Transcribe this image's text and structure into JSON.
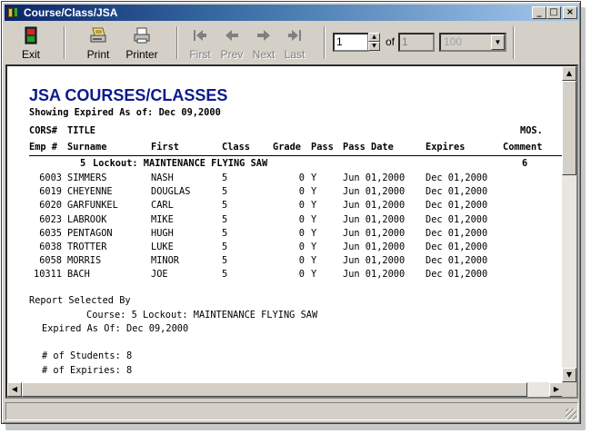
{
  "window": {
    "title": "Course/Class/JSA"
  },
  "toolbar": {
    "exit": "Exit",
    "print": "Print",
    "printer": "Printer",
    "first": "First",
    "prev": "Prev",
    "next": "Next",
    "last": "Last",
    "page_value": "1",
    "of_label": "of",
    "page_total": "1",
    "zoom": "100"
  },
  "report": {
    "title": "JSA COURSES/CLASSES",
    "subtitle": "Showing Expired As of: Dec 09,2000",
    "header1": {
      "cors": "CORS#",
      "title": "TITLE",
      "mos": "MOS."
    },
    "header2": {
      "emp": "Emp #",
      "surname": "Surname",
      "first": "First",
      "class": "Class",
      "grade": "Grade",
      "pass": "Pass",
      "pass_date": "Pass Date",
      "expires": "Expires",
      "comment": "Comment"
    },
    "group": {
      "num": "5",
      "title": "Lockout: MAINTENANCE FLYING SAW",
      "mos": "6"
    },
    "rows": [
      {
        "emp": "6003",
        "surname": "SIMMERS",
        "first": "NASH",
        "class": "5",
        "grade": "0",
        "pass": "Y",
        "pass_date": "Jun 01,2000",
        "expires": "Dec 01,2000"
      },
      {
        "emp": "6019",
        "surname": "CHEYENNE",
        "first": "DOUGLAS",
        "class": "5",
        "grade": "0",
        "pass": "Y",
        "pass_date": "Jun 01,2000",
        "expires": "Dec 01,2000"
      },
      {
        "emp": "6020",
        "surname": "GARFUNKEL",
        "first": "CARL",
        "class": "5",
        "grade": "0",
        "pass": "Y",
        "pass_date": "Jun 01,2000",
        "expires": "Dec 01,2000"
      },
      {
        "emp": "6023",
        "surname": "LABROOK",
        "first": "MIKE",
        "class": "5",
        "grade": "0",
        "pass": "Y",
        "pass_date": "Jun 01,2000",
        "expires": "Dec 01,2000"
      },
      {
        "emp": "6035",
        "surname": "PENTAGON",
        "first": "HUGH",
        "class": "5",
        "grade": "0",
        "pass": "Y",
        "pass_date": "Jun 01,2000",
        "expires": "Dec 01,2000"
      },
      {
        "emp": "6038",
        "surname": "TROTTER",
        "first": "LUKE",
        "class": "5",
        "grade": "0",
        "pass": "Y",
        "pass_date": "Jun 01,2000",
        "expires": "Dec 01,2000"
      },
      {
        "emp": "6058",
        "surname": "MORRIS",
        "first": "MINOR",
        "class": "5",
        "grade": "0",
        "pass": "Y",
        "pass_date": "Jun 01,2000",
        "expires": "Dec 01,2000"
      },
      {
        "emp": "10311",
        "surname": "BACH",
        "first": "JOE",
        "class": "5",
        "grade": "0",
        "pass": "Y",
        "pass_date": "Jun 01,2000",
        "expires": "Dec 01,2000"
      }
    ],
    "summary": {
      "selected_by": "Report Selected By",
      "course": "Course: 5 Lockout: MAINTENANCE FLYING SAW",
      "expired": "Expired As Of: Dec 09,2000",
      "students": "# of Students: 8",
      "expiries": "# of Expiries: 8"
    }
  },
  "colors": {
    "title_blue": "#0c1a8c",
    "titlebar_start": "#0a246a",
    "chrome": "#d4d0c8"
  }
}
